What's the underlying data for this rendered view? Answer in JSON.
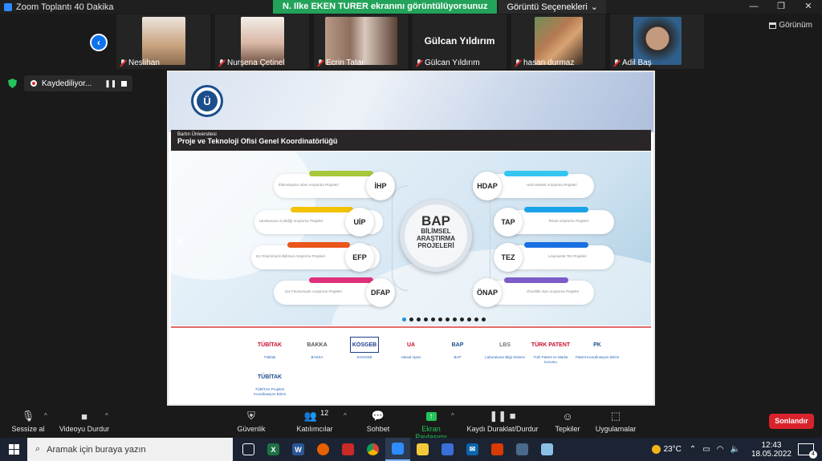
{
  "window": {
    "title": "Zoom Toplantı 40 Dakika",
    "controls": [
      "—",
      "❐",
      "✕"
    ]
  },
  "share_banner": {
    "presenter_text": "N. Ilke EKEN TURER ekranını görüntülüyorsunuz",
    "options_label": "Görüntü Seçenekleri"
  },
  "view_label": "Görünüm",
  "participants": [
    {
      "name": "Neslihan",
      "bg": "#c9a27e"
    },
    {
      "name": "Nurşena Çetinel",
      "bg": "#d8b7a6"
    },
    {
      "name": "Ecrin Tatar",
      "bg": "#a88a7a"
    },
    {
      "name": "Gülcan Yıldırım",
      "display_name": "Gülcan Yıldırım",
      "bg": "#242424"
    },
    {
      "name": "hasan durmaz",
      "bg": "#b47a52"
    },
    {
      "name": "Adil Baş",
      "bg": "#2f5f8a"
    }
  ],
  "recording": {
    "label": "Kaydediliyor..."
  },
  "slide": {
    "org_small": "Bartın Üniversitesi",
    "org_title": "Proje ve Teknoloji Ofisi Genel Koordinatörlüğü",
    "logo_letter": "Ü",
    "center": {
      "big": "BAP",
      "line1": "BİLİMSEL",
      "line2": "ARAŞTIRMA",
      "line3": "PROJELERİ"
    },
    "left_nodes": [
      {
        "code": "İHP",
        "desc": "İhtisaslaşma Alanı Araştırma Projeleri",
        "color": "#a6c83a"
      },
      {
        "code": "UİP",
        "desc": "Uluslararası İş Birliği Araştırma Projeleri",
        "color": "#f2c200"
      },
      {
        "code": "EFP",
        "desc": "Eş Finansmanlı Bilimsel Araştırma Projeleri",
        "color": "#e8561a"
      },
      {
        "code": "DFAP",
        "desc": "Dış Finansmanlı Araştırma Projeleri",
        "color": "#e0307a"
      }
    ],
    "right_nodes": [
      {
        "code": "HDAP",
        "desc": "Hızlı Destek Araştırma Projeleri",
        "color": "#35c6f0"
      },
      {
        "code": "TAP",
        "desc": "Temel Araştırma Projeleri",
        "color": "#1aa3e8"
      },
      {
        "code": "TEZ",
        "desc": "Lisansüstü Tez Projeleri",
        "color": "#1a6fe0"
      },
      {
        "code": "ÖNAP",
        "desc": "Öncelikli Alan Araştırma Projeleri",
        "color": "#7b5cc8"
      }
    ],
    "carousel_dots": 12,
    "carousel_active": 0,
    "partners": [
      {
        "logo": "TÜBİTAK",
        "label": "Tübitak",
        "color": "#c8102e"
      },
      {
        "logo": "BAKKA",
        "label": "BAKKA",
        "color": "#555"
      },
      {
        "logo": "KOSGEB",
        "label": "KOSGEB",
        "color": "#1d3f8c"
      },
      {
        "logo": "UA",
        "label": "Ulusal Ajans",
        "color": "#c8102e"
      },
      {
        "logo": "BAP",
        "label": "BAP",
        "color": "#1c4e8c"
      },
      {
        "logo": "LBS",
        "label": "Laboratuvar Bilgi Sistemi",
        "color": "#777"
      },
      {
        "logo": "TÜRK PATENT",
        "label": "Türk Patent ve Marka Kurumu",
        "color": "#c8102e"
      },
      {
        "logo": "PK",
        "label": "Patent Koordinasyon Birimi",
        "color": "#1c4e8c"
      }
    ],
    "partner_row2": {
      "logo": "TÜBİTAK",
      "label": "TÜBİTAK Projeleri Koordinasyon Birimi"
    }
  },
  "toolbar": {
    "mute": "Sessize al",
    "video": "Videoyu Durdur",
    "security": "Güvenlik",
    "participants": "Katılımcılar",
    "participants_count": "12",
    "chat": "Sohbet",
    "share": "Ekran Paylaşımı",
    "record": "Kaydı Duraklat/Durdur",
    "reactions": "Tepkiler",
    "apps": "Uygulamalar",
    "end": "Sonlandır"
  },
  "taskbar": {
    "search_placeholder": "Aramak için buraya yazın",
    "temperature": "23°C",
    "time": "12:43",
    "date": "18.05.2022",
    "notif_count": "4"
  }
}
